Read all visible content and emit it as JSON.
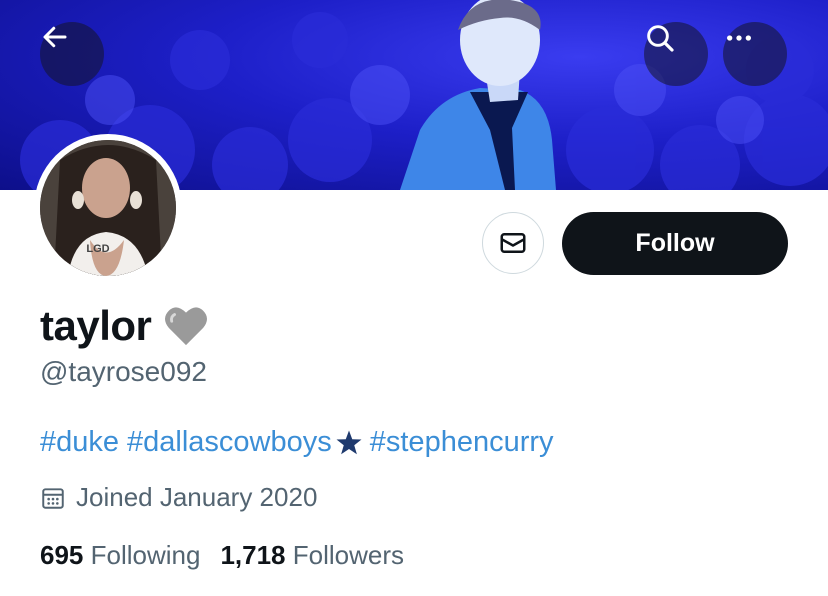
{
  "header": {
    "back_icon": "arrow-left-icon",
    "search_icon": "search-icon",
    "more_icon": "more-horizontal-icon"
  },
  "profile": {
    "avatar_shirt_text": "LGD",
    "display_name": "taylor",
    "name_emoji": "🩶",
    "handle": "@tayrose092",
    "bio_tags": [
      "#duke",
      "#dallascowboys",
      "#stephencurry"
    ],
    "bio_star": "★",
    "joined": "Joined January 2020",
    "following_count": "695",
    "following_label": "Following",
    "followers_count": "1,718",
    "followers_label": "Followers"
  },
  "actions": {
    "message_icon": "mail-icon",
    "follow_label": "Follow"
  },
  "colors": {
    "banner": "#1d1fc8",
    "link": "#3b8ed6",
    "follow_bg": "#0f1419",
    "muted": "#536471"
  }
}
